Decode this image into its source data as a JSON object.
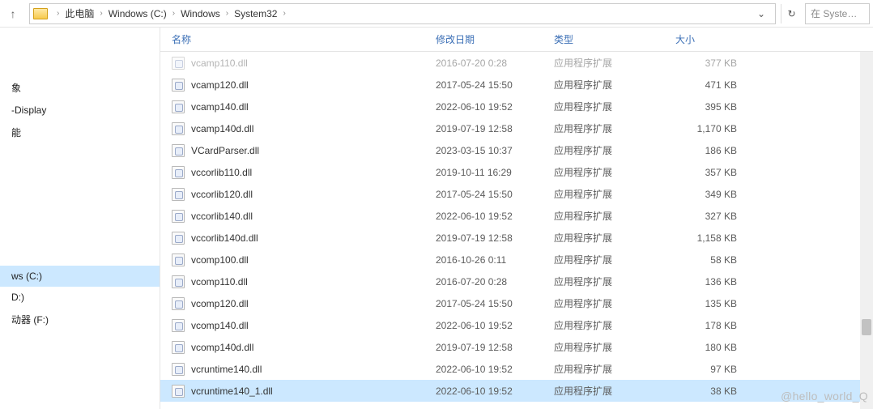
{
  "breadcrumb": {
    "items": [
      "此电脑",
      "Windows (C:)",
      "Windows",
      "System32"
    ]
  },
  "search": {
    "placeholder": "在 Syste…"
  },
  "sidebar": {
    "top": [
      "象",
      "-Display",
      "能"
    ],
    "drives": [
      {
        "label": "ws (C:)",
        "selected": true
      },
      {
        "label": "D:)",
        "selected": false
      },
      {
        "label": "动器 (F:)",
        "selected": false
      }
    ]
  },
  "columns": {
    "name": "名称",
    "date": "修改日期",
    "type": "类型",
    "size": "大小"
  },
  "files": [
    {
      "name": "vcamp110.dll",
      "date": "2016-07-20 0:28",
      "type": "应用程序扩展",
      "size": "377 KB",
      "dim": true
    },
    {
      "name": "vcamp120.dll",
      "date": "2017-05-24 15:50",
      "type": "应用程序扩展",
      "size": "471 KB"
    },
    {
      "name": "vcamp140.dll",
      "date": "2022-06-10 19:52",
      "type": "应用程序扩展",
      "size": "395 KB"
    },
    {
      "name": "vcamp140d.dll",
      "date": "2019-07-19 12:58",
      "type": "应用程序扩展",
      "size": "1,170 KB"
    },
    {
      "name": "VCardParser.dll",
      "date": "2023-03-15 10:37",
      "type": "应用程序扩展",
      "size": "186 KB"
    },
    {
      "name": "vccorlib110.dll",
      "date": "2019-10-11 16:29",
      "type": "应用程序扩展",
      "size": "357 KB"
    },
    {
      "name": "vccorlib120.dll",
      "date": "2017-05-24 15:50",
      "type": "应用程序扩展",
      "size": "349 KB"
    },
    {
      "name": "vccorlib140.dll",
      "date": "2022-06-10 19:52",
      "type": "应用程序扩展",
      "size": "327 KB"
    },
    {
      "name": "vccorlib140d.dll",
      "date": "2019-07-19 12:58",
      "type": "应用程序扩展",
      "size": "1,158 KB"
    },
    {
      "name": "vcomp100.dll",
      "date": "2016-10-26 0:11",
      "type": "应用程序扩展",
      "size": "58 KB"
    },
    {
      "name": "vcomp110.dll",
      "date": "2016-07-20 0:28",
      "type": "应用程序扩展",
      "size": "136 KB"
    },
    {
      "name": "vcomp120.dll",
      "date": "2017-05-24 15:50",
      "type": "应用程序扩展",
      "size": "135 KB"
    },
    {
      "name": "vcomp140.dll",
      "date": "2022-06-10 19:52",
      "type": "应用程序扩展",
      "size": "178 KB"
    },
    {
      "name": "vcomp140d.dll",
      "date": "2019-07-19 12:58",
      "type": "应用程序扩展",
      "size": "180 KB"
    },
    {
      "name": "vcruntime140.dll",
      "date": "2022-06-10 19:52",
      "type": "应用程序扩展",
      "size": "97 KB"
    },
    {
      "name": "vcruntime140_1.dll",
      "date": "2022-06-10 19:52",
      "type": "应用程序扩展",
      "size": "38 KB",
      "selected": true
    }
  ],
  "watermark": "@hello_world_Q"
}
